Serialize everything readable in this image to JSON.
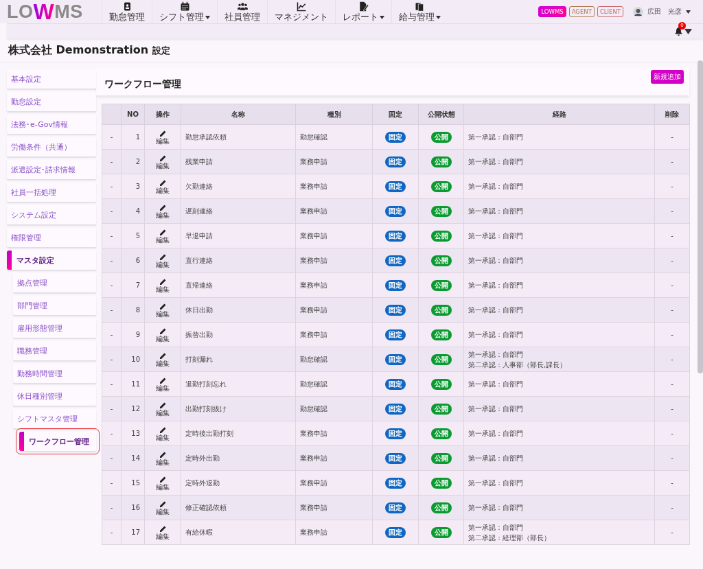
{
  "header": {
    "logo": {
      "prefix": "LO",
      "mark": "W",
      "suffix": "MS"
    },
    "nav": [
      {
        "label": "勤怠管理",
        "has_menu": false
      },
      {
        "label": "シフト管理",
        "has_menu": true
      },
      {
        "label": "社員管理",
        "has_menu": false
      },
      {
        "label": "マネジメント",
        "has_menu": false
      },
      {
        "label": "レポート",
        "has_menu": true
      },
      {
        "label": "給与管理",
        "has_menu": true
      }
    ],
    "badges": [
      {
        "label": "LOWMS",
        "kind": "filled",
        "color": "#d400d4"
      },
      {
        "label": "AGENT",
        "kind": "outline",
        "color": "#b07a50"
      },
      {
        "label": "CLIENT",
        "kind": "outline",
        "color": "#c86a6a"
      }
    ],
    "user": {
      "name": "広田　光彦"
    },
    "notifications": {
      "count": "0"
    }
  },
  "page_title": {
    "company": "株式会社 Demonstration",
    "suffix": "設定"
  },
  "sidebar": {
    "items": [
      {
        "label": "基本設定",
        "selected": false
      },
      {
        "label": "勤怠設定",
        "selected": false
      },
      {
        "label": "法務･e-Gov情報",
        "selected": false
      },
      {
        "label": "労働条件（共通）",
        "selected": false
      },
      {
        "label": "派遣設定･請求情報",
        "selected": false
      },
      {
        "label": "社員一括処理",
        "selected": false
      },
      {
        "label": "システム設定",
        "selected": false
      },
      {
        "label": "権限管理",
        "selected": false
      },
      {
        "label": "マスタ設定",
        "selected": true,
        "children": [
          {
            "label": "拠点管理",
            "selected": false,
            "highlighted": false
          },
          {
            "label": "部門管理",
            "selected": false,
            "highlighted": false
          },
          {
            "label": "雇用形態管理",
            "selected": false,
            "highlighted": false
          },
          {
            "label": "職務管理",
            "selected": false,
            "highlighted": false
          },
          {
            "label": "勤務時間管理",
            "selected": false,
            "highlighted": false
          },
          {
            "label": "休日種別管理",
            "selected": false,
            "highlighted": false
          },
          {
            "label": "シフトマスタ管理",
            "selected": false,
            "highlighted": false
          },
          {
            "label": "ワークフロー管理",
            "selected": true,
            "highlighted": true
          }
        ]
      }
    ]
  },
  "content": {
    "title": "ワークフロー管理",
    "add_button": "新規追加",
    "table": {
      "columns": [
        "NO",
        "操作",
        "名称",
        "種別",
        "固定",
        "公開状態",
        "経路",
        "削除"
      ],
      "rows": [
        {
          "marker": "-",
          "no": "1",
          "edit": "編集",
          "name": "勤怠承認依頼",
          "type": "勤怠確認",
          "fixed": "固定",
          "public": "公開",
          "route": [
            "第一承認：自部門"
          ],
          "delete": "-"
        },
        {
          "marker": "-",
          "no": "2",
          "edit": "編集",
          "name": "残業申請",
          "type": "業務申請",
          "fixed": "固定",
          "public": "公開",
          "route": [
            "第一承認：自部門"
          ],
          "delete": "-"
        },
        {
          "marker": "-",
          "no": "3",
          "edit": "編集",
          "name": "欠勤連絡",
          "type": "業務申請",
          "fixed": "固定",
          "public": "公開",
          "route": [
            "第一承認：自部門"
          ],
          "delete": "-"
        },
        {
          "marker": "-",
          "no": "4",
          "edit": "編集",
          "name": "遅刻連絡",
          "type": "業務申請",
          "fixed": "固定",
          "public": "公開",
          "route": [
            "第一承認：自部門"
          ],
          "delete": "-"
        },
        {
          "marker": "-",
          "no": "5",
          "edit": "編集",
          "name": "早退申請",
          "type": "業務申請",
          "fixed": "固定",
          "public": "公開",
          "route": [
            "第一承認：自部門"
          ],
          "delete": "-"
        },
        {
          "marker": "-",
          "no": "6",
          "edit": "編集",
          "name": "直行連絡",
          "type": "業務申請",
          "fixed": "固定",
          "public": "公開",
          "route": [
            "第一承認：自部門"
          ],
          "delete": "-"
        },
        {
          "marker": "-",
          "no": "7",
          "edit": "編集",
          "name": "直帰連絡",
          "type": "業務申請",
          "fixed": "固定",
          "public": "公開",
          "route": [
            "第一承認：自部門"
          ],
          "delete": "-"
        },
        {
          "marker": "-",
          "no": "8",
          "edit": "編集",
          "name": "休日出勤",
          "type": "業務申請",
          "fixed": "固定",
          "public": "公開",
          "route": [
            "第一承認：自部門"
          ],
          "delete": "-"
        },
        {
          "marker": "-",
          "no": "9",
          "edit": "編集",
          "name": "振替出勤",
          "type": "業務申請",
          "fixed": "固定",
          "public": "公開",
          "route": [
            "第一承認：自部門"
          ],
          "delete": "-"
        },
        {
          "marker": "-",
          "no": "10",
          "edit": "編集",
          "name": "打刻漏れ",
          "type": "勤怠確認",
          "fixed": "固定",
          "public": "公開",
          "route": [
            "第一承認：自部門",
            "第二承認：人事部（部長,課長）"
          ],
          "delete": "-"
        },
        {
          "marker": "-",
          "no": "11",
          "edit": "編集",
          "name": "退勤打刻忘れ",
          "type": "勤怠確認",
          "fixed": "固定",
          "public": "公開",
          "route": [
            "第一承認：自部門"
          ],
          "delete": "-"
        },
        {
          "marker": "-",
          "no": "12",
          "edit": "編集",
          "name": "出勤打刻抜け",
          "type": "勤怠確認",
          "fixed": "固定",
          "public": "公開",
          "route": [
            "第一承認：自部門"
          ],
          "delete": "-"
        },
        {
          "marker": "-",
          "no": "13",
          "edit": "編集",
          "name": "定時後出勤打刻",
          "type": "業務申請",
          "fixed": "固定",
          "public": "公開",
          "route": [
            "第一承認：自部門"
          ],
          "delete": "-"
        },
        {
          "marker": "-",
          "no": "14",
          "edit": "編集",
          "name": "定時外出勤",
          "type": "業務申請",
          "fixed": "固定",
          "public": "公開",
          "route": [
            "第一承認：自部門"
          ],
          "delete": "-"
        },
        {
          "marker": "-",
          "no": "15",
          "edit": "編集",
          "name": "定時外退勤",
          "type": "業務申請",
          "fixed": "固定",
          "public": "公開",
          "route": [
            "第一承認：自部門"
          ],
          "delete": "-"
        },
        {
          "marker": "-",
          "no": "16",
          "edit": "編集",
          "name": "修正確認依頼",
          "type": "業務申請",
          "fixed": "固定",
          "public": "公開",
          "route": [
            "第一承認：自部門"
          ],
          "delete": "-"
        },
        {
          "marker": "-",
          "no": "17",
          "edit": "編集",
          "name": "有給休暇",
          "type": "業務申請",
          "fixed": "固定",
          "public": "公開",
          "route": [
            "第一承認：自部門",
            "第二承認：経理部（部長）"
          ],
          "delete": "-"
        }
      ]
    }
  }
}
